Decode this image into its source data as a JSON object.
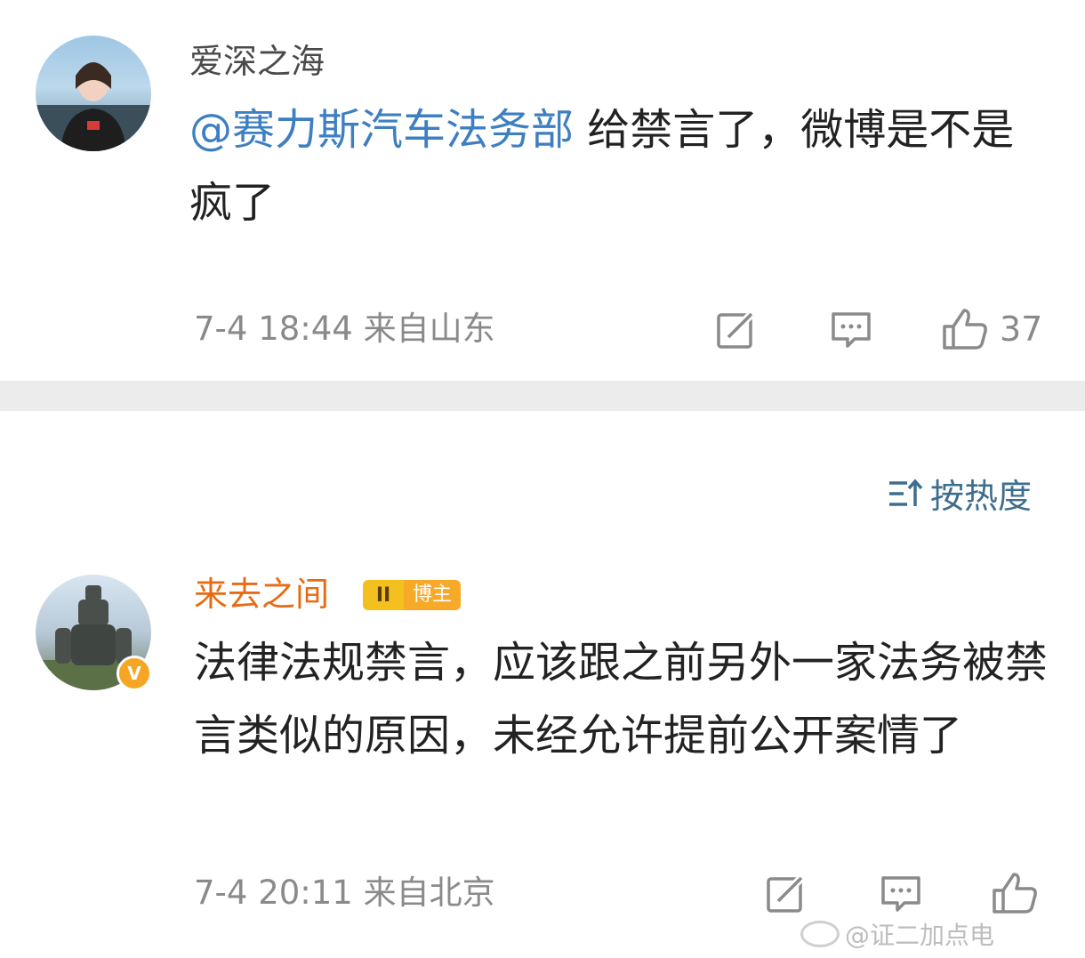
{
  "comment1": {
    "username": "爱深之海",
    "mention": "@赛力斯汽车法务部",
    "text": " 给禁言了，微博是不是疯了",
    "meta": "7-4 18:44 来自山东",
    "like_count": "37"
  },
  "sort": {
    "icon": "sort-icon",
    "label": "按热度"
  },
  "comment2": {
    "username": "来去之间",
    "badge_level": "II",
    "badge_label": "博主",
    "verified_mark": "V",
    "text": "法律法规禁言，应该跟之前另外一家法务被禁言类似的原因，未经允许提前公开案情了",
    "meta": "7-4 20:11 来自北京"
  },
  "watermark": {
    "text": "@证二加点电"
  },
  "colors": {
    "mention": "#3d7fc1",
    "vip_username": "#e86b14",
    "meta": "#8a8a8a",
    "separator": "#ececec",
    "badge": "#f7a928"
  }
}
